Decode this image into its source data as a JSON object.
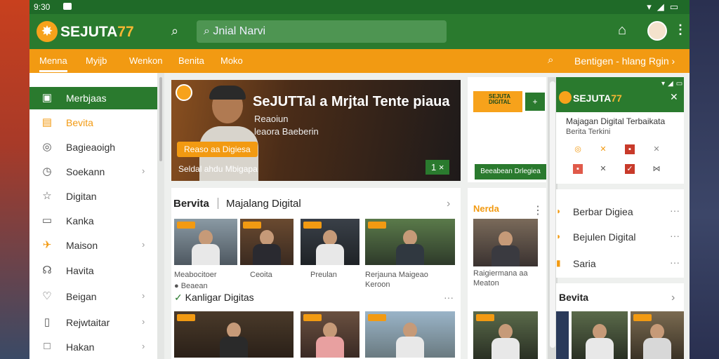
{
  "status": {
    "time": "9:30"
  },
  "header": {
    "brand": "SEJUTA",
    "brand_num": "77",
    "search_value": "Jnial Narvi"
  },
  "nav": {
    "items": [
      "Menna",
      "Myijb",
      "Wenkon",
      "Benita",
      "Moko"
    ],
    "right_label": "Bentigen - hlang Rgin"
  },
  "sidebar": {
    "items": [
      {
        "label": "Merbjaas",
        "icon": "calendar-icon"
      },
      {
        "label": "Bevita",
        "icon": "document-icon"
      },
      {
        "label": "Bagieaoigh",
        "icon": "globe-icon"
      },
      {
        "label": "Soekann",
        "icon": "clock-icon"
      },
      {
        "label": "Digitan",
        "icon": "star-icon"
      },
      {
        "label": "Kanka",
        "icon": "grid-icon"
      },
      {
        "label": "Maison",
        "icon": "plane-icon"
      },
      {
        "label": "Havita",
        "icon": "person-icon"
      },
      {
        "label": "Beigan",
        "icon": "heart-icon"
      },
      {
        "label": "Rejwtaitar",
        "icon": "bookmark-icon"
      },
      {
        "label": "Hakan",
        "icon": "square-icon"
      }
    ]
  },
  "hero": {
    "title": "SeJUTTal a Mrjtal Tente piaua",
    "line1": "Reaoiun",
    "line2": "leaora Baeberin",
    "pill": "Reaso aa Digiesa",
    "caption": "Seldal ahdu Mbigapa",
    "page": "1 ×"
  },
  "category": {
    "title": "Bervita",
    "subtitle": "Majalang Digital",
    "items": [
      {
        "caption": "Meabocitoer"
      },
      {
        "caption": "Ceoita"
      },
      {
        "caption": "Preulan"
      },
      {
        "caption": "Rerjauna Maigeao"
      },
      {
        "caption": "Keroon"
      }
    ],
    "tag": "Beaean",
    "subheading": "Kanligar Digitas"
  },
  "recommend": {
    "brand_text": "SEJUTA DIGITAL",
    "add": "+",
    "button": "Beeabean Drlegiea"
  },
  "col2": {
    "title": "Nerda",
    "caption1": "Raigiermana aa",
    "caption2": "Meaton"
  },
  "popup": {
    "name": "SEJUTA",
    "name_num": "77",
    "line1": "Majagan Digital Terbaikata",
    "line2": "Berita Terkini"
  },
  "right_list": {
    "items": [
      "Berbar Digiea",
      "Bejulen Digital",
      "Saria"
    ]
  },
  "bevita": {
    "title": "Bevita"
  }
}
